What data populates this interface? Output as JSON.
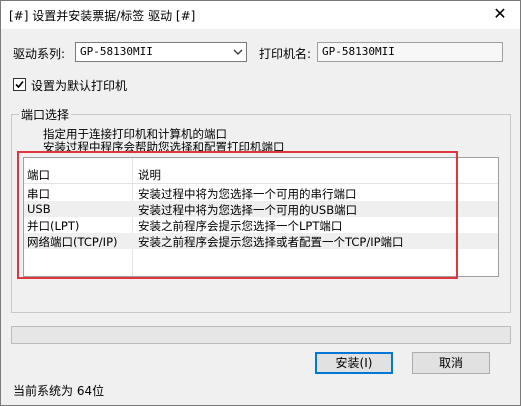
{
  "window": {
    "title": "[#] 设置并安装票据/标签 驱动 [#]",
    "close_glyph": "✕"
  },
  "driver_series": {
    "label": "驱动系列:",
    "value": "GP-58130MII"
  },
  "printer_name": {
    "label": "打印机名:",
    "value": "GP-58130MII"
  },
  "default_printer": {
    "label": "设置为默认打印机",
    "checked": true
  },
  "port_group": {
    "title": "端口选择",
    "desc_line1": "指定用于连接打印机和计算机的端口",
    "desc_line2": "安装过程中程序会帮助您选择和配置打印机端口",
    "columns": [
      "端口",
      "说明"
    ],
    "rows": [
      {
        "port": "串口",
        "desc": "安装过程中将为您选择一个可用的串行端口"
      },
      {
        "port": "USB",
        "desc": "安装过程中将为您选择一个可用的USB端口"
      },
      {
        "port": "并口(LPT)",
        "desc": "安装之前程序会提示您选择一个LPT端口"
      },
      {
        "port": "网络端口(TCP/IP)",
        "desc": "安装之前程序会提示您选择或者配置一个TCP/IP端口"
      }
    ]
  },
  "buttons": {
    "install": "安装(I)",
    "cancel": "取消"
  },
  "status": {
    "system_info": "当前系统为 64位"
  },
  "colors": {
    "highlight_box": "#e0353c"
  }
}
